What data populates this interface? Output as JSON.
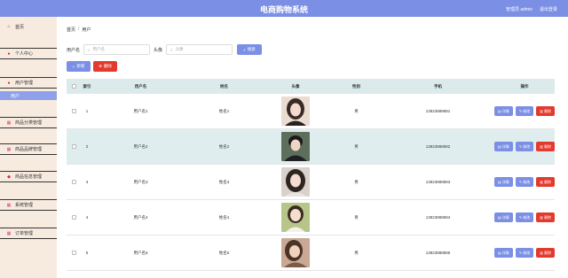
{
  "header": {
    "title": "电商购物系统",
    "user_label": "管理员 admin",
    "logout": "退出登录"
  },
  "sidebar": {
    "home": "首页",
    "items": [
      {
        "label": "个人中心",
        "icon": "user-icon"
      },
      {
        "label": "用户管理",
        "icon": "users-icon"
      },
      {
        "label": "商品分类管理",
        "icon": "grid-icon"
      },
      {
        "label": "商品品牌管理",
        "icon": "grid-icon"
      },
      {
        "label": "商品信息管理",
        "icon": "tag-icon"
      },
      {
        "label": "系统管理",
        "icon": "grid-icon"
      },
      {
        "label": "订单管理",
        "icon": "grid-icon"
      }
    ],
    "active_sub": "用户"
  },
  "breadcrumb": {
    "home": "首页",
    "sep": "/",
    "current": "用户"
  },
  "search": {
    "username_label": "用户名",
    "username_placeholder": "用户名",
    "avatar_label": "头像",
    "avatar_placeholder": "头像",
    "search_button": "搜索"
  },
  "toolbar": {
    "add": "新增",
    "delete": "删除"
  },
  "table": {
    "headers": [
      "索引",
      "用户名",
      "姓名",
      "头像",
      "性别",
      "手机",
      "操作"
    ],
    "rows": [
      {
        "idx": "1",
        "username": "用户名1",
        "name": "姓名1",
        "sex": "男",
        "phone": "13823888881"
      },
      {
        "idx": "2",
        "username": "用户名2",
        "name": "姓名2",
        "sex": "男",
        "phone": "13823888882"
      },
      {
        "idx": "3",
        "username": "用户名3",
        "name": "姓名3",
        "sex": "男",
        "phone": "13823888883"
      },
      {
        "idx": "4",
        "username": "用户名4",
        "name": "姓名4",
        "sex": "男",
        "phone": "13823888884"
      },
      {
        "idx": "5",
        "username": "用户名5",
        "name": "姓名5",
        "sex": "男",
        "phone": "13823888885"
      }
    ],
    "op_view": "详情",
    "op_edit": "修改",
    "op_delete": "删除"
  },
  "colors": {
    "accent": "#7b8fe5",
    "danger": "#e33a2e",
    "sidebar_bg": "#f7ebe0",
    "row_alt": "#e0edee"
  }
}
